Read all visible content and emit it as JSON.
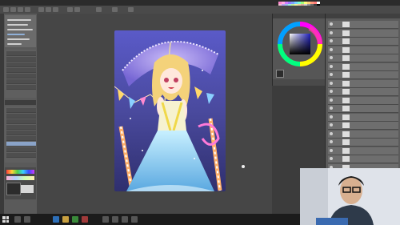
{
  "menu": {
    "items": [
      "",
      "",
      "",
      "",
      "",
      "",
      "",
      "",
      "",
      "",
      "",
      ""
    ]
  },
  "window": {
    "title": ""
  },
  "tool_properties": {
    "rows": [
      "",
      "",
      "",
      "",
      "",
      "",
      "",
      "",
      "",
      "",
      ""
    ]
  },
  "layers": {
    "items": [
      "",
      "",
      "",
      "",
      "",
      "",
      "",
      "",
      "",
      "",
      "",
      "",
      "",
      "",
      "",
      "",
      "",
      "",
      "",
      "",
      "",
      ""
    ],
    "selected_index": 18
  },
  "colors": {
    "current_main": "#6aa0d8",
    "wheel_square": "#3b3b9a",
    "palette": [
      "#ff8ad0",
      "#ffb0e0",
      "#d07cff",
      "#9a7cff",
      "#7ca0ff",
      "#7cd4ff",
      "#7cffd4",
      "#a0ff7c",
      "#ffff7c",
      "#ffd07c",
      "#ff9a7c",
      "#ff7c7c",
      "#ffffff",
      "#f0c0d0",
      "#c0a0f0",
      "#a0c0f0",
      "#a0f0e0",
      "#c0f0a0",
      "#f0f0a0",
      "#f0d0a0",
      "#e0b0a0",
      "#d0d0d0",
      "#9a9a9a",
      "#6a6a6a",
      "#3a3a3a",
      "#000000",
      "#e07070",
      "#e0a070",
      "#e0e070",
      "#70e070",
      "#70e0e0",
      "#7070e0",
      "#e070e0",
      "#b0b0ff",
      "#b0ffb0",
      "#ffb0b0",
      "#ffffb0",
      "#b0ffff",
      "#ffb0ff"
    ]
  },
  "taskbar": {
    "tray_time": ""
  },
  "icons": [
    "start-icon",
    "brush-icon",
    "eye-icon",
    "cursor-icon"
  ]
}
